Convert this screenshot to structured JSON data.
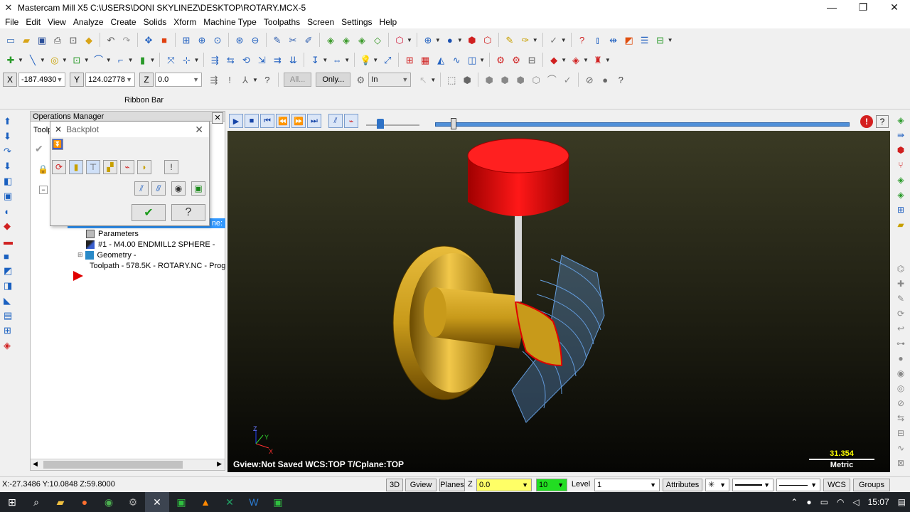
{
  "window": {
    "title": "Mastercam Mill X5  C:\\USERS\\DONI SKYLINEZ\\DESKTOP\\ROTARY.MCX-5",
    "minimize": "—",
    "maximize": "❐",
    "close": "✕"
  },
  "menu": [
    "File",
    "Edit",
    "View",
    "Analyze",
    "Create",
    "Solids",
    "Xform",
    "Machine Type",
    "Toolpaths",
    "Screen",
    "Settings",
    "Help"
  ],
  "coord_bar": {
    "x_label": "X",
    "x_value": "-187.4930",
    "y_label": "Y",
    "y_value": "124.02778",
    "z_label": "Z",
    "z_value": "0.0",
    "all_label": "All...",
    "only_label": "Only...",
    "units_value": "In"
  },
  "ribbon_label": "Ribbon Bar",
  "operations_manager": {
    "title": "Operations Manager",
    "tab_label": "Toolp",
    "tree": [
      {
        "label": "Parameters",
        "icon": "folder-icon"
      },
      {
        "label": "#1 - M4.00 ENDMILL2 SPHERE -",
        "icon": "tool-icon"
      },
      {
        "label": "Geometry -",
        "icon": "geometry-icon"
      },
      {
        "label": "Toolpath - 578.5K - ROTARY.NC - Prog",
        "icon": "toolpath-icon"
      }
    ],
    "selected_row_tail": "ne:"
  },
  "backplot": {
    "title": "Backplot",
    "ok_label": "✔",
    "help_label": "?"
  },
  "viewport": {
    "gview_text": "Gview:Not Saved   WCS:TOP   T/Cplane:TOP",
    "scale_value": "31.354",
    "scale_unit": "Metric",
    "axis_x": "X",
    "axis_y": "Y",
    "axis_z": "Z"
  },
  "status_bar": {
    "coords": "X:-27.3486   Y:10.0848  Z:59.8000",
    "btn_3d": "3D",
    "btn_gview": "Gview",
    "btn_planes": "Planes",
    "z_label": "Z",
    "z_value": "0.0",
    "color_value": "10",
    "level_label": "Level",
    "level_value": "1",
    "attributes_label": "Attributes",
    "wcs_label": "WCS",
    "groups_label": "Groups"
  },
  "taskbar": {
    "time": "15:07"
  },
  "colors": {
    "viewport_top": "#3a3a24",
    "viewport_bottom": "#060604",
    "part_gold": "#c89a1a",
    "tool_holder_red": "#e01010",
    "toolpath_blue": "#6aa8f0",
    "progress_blue": "#4f8fd8",
    "color_swatch_green": "#22dd22",
    "z_field_yellow": "#ffff66"
  }
}
